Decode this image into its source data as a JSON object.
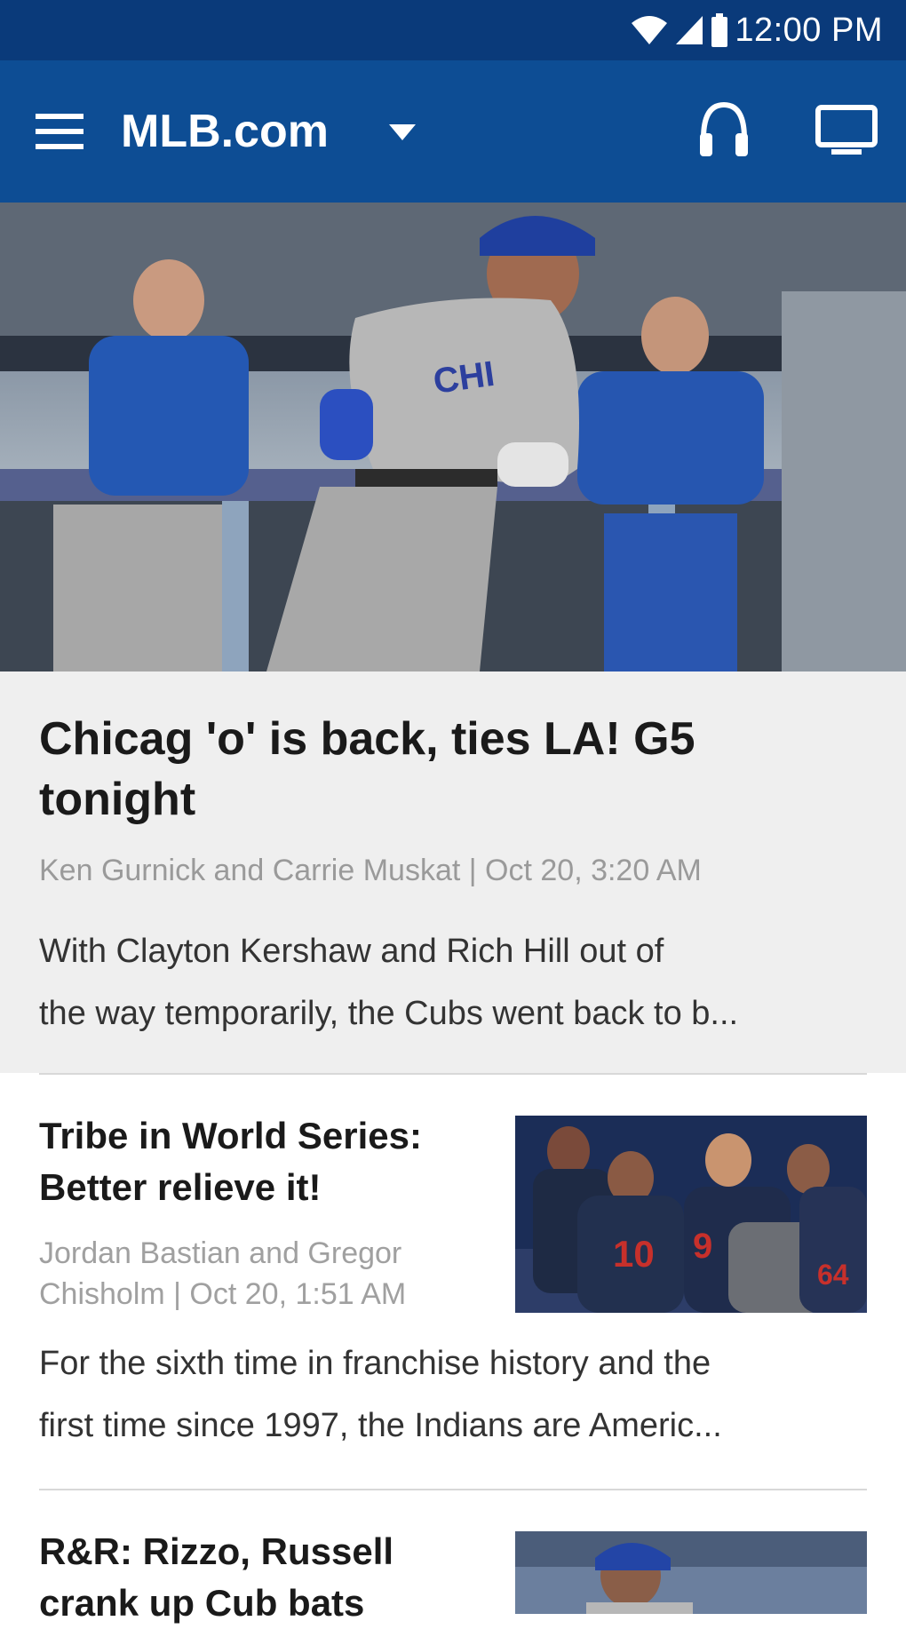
{
  "status_bar": {
    "time": "12:00 PM",
    "icons": [
      "wifi-icon",
      "signal-icon",
      "battery-icon"
    ]
  },
  "app_bar": {
    "title": "MLB.com",
    "icons": [
      "menu-icon",
      "dropdown-icon",
      "headphones-icon",
      "tv-icon"
    ],
    "color": "#0d4d94"
  },
  "lead_story": {
    "title": "Chicag 'o' is back, ties LA! G5 tonight",
    "meta": "Ken Gurnick and Carrie Muskat | Oct 20, 3:20 AM",
    "description_line1": "With Clayton Kershaw and Rich Hill out of",
    "description_line2": "the way temporarily, the Cubs went back to b..."
  },
  "stories": [
    {
      "title": "Tribe in World Series: Better relieve it!",
      "meta": "Jordan Bastian and Gregor Chisholm | Oct 20, 1:51 AM",
      "description_line1": "For the sixth time in franchise history and the",
      "description_line2": "first time since 1997, the Indians are Americ..."
    },
    {
      "title": "R&R: Rizzo, Russell crank up Cub bats"
    }
  ]
}
